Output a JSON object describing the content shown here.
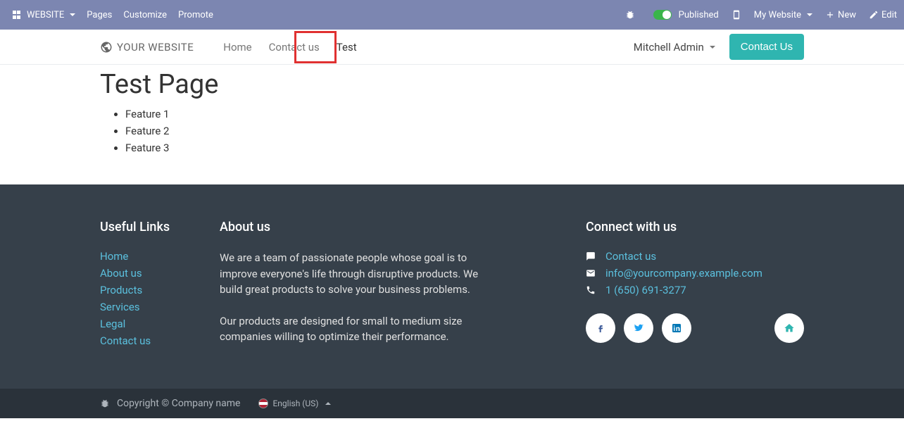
{
  "topbar": {
    "brand": "WEBSITE",
    "menu": [
      "Pages",
      "Customize",
      "Promote"
    ],
    "publish_label": "Published",
    "site_label": "My Website",
    "new_label": "New",
    "edit_label": "Edit"
  },
  "header": {
    "brand": "YOUR WEBSITE",
    "nav": [
      {
        "label": "Home",
        "active": false
      },
      {
        "label": "Contact us",
        "active": false
      },
      {
        "label": "Test",
        "active": true
      }
    ],
    "user": "Mitchell Admin",
    "cta": "Contact Us"
  },
  "page": {
    "title": "Test Page",
    "features": [
      "Feature 1",
      "Feature 2",
      "Feature 3"
    ]
  },
  "footer": {
    "links_heading": "Useful Links",
    "links": [
      "Home",
      "About us",
      "Products",
      "Services",
      "Legal",
      "Contact us"
    ],
    "about_heading": "About us",
    "about_p1": "We are a team of passionate people whose goal is to improve everyone's life through disruptive products. We build great products to solve your business problems.",
    "about_p2": "Our products are designed for small to medium size companies willing to optimize their performance.",
    "connect_heading": "Connect with us",
    "contact_link": "Contact us",
    "email": "info@yourcompany.example.com",
    "phone": "1 (650) 691-3277"
  },
  "subfooter": {
    "copyright": "Copyright © Company name",
    "language": "English (US)"
  }
}
